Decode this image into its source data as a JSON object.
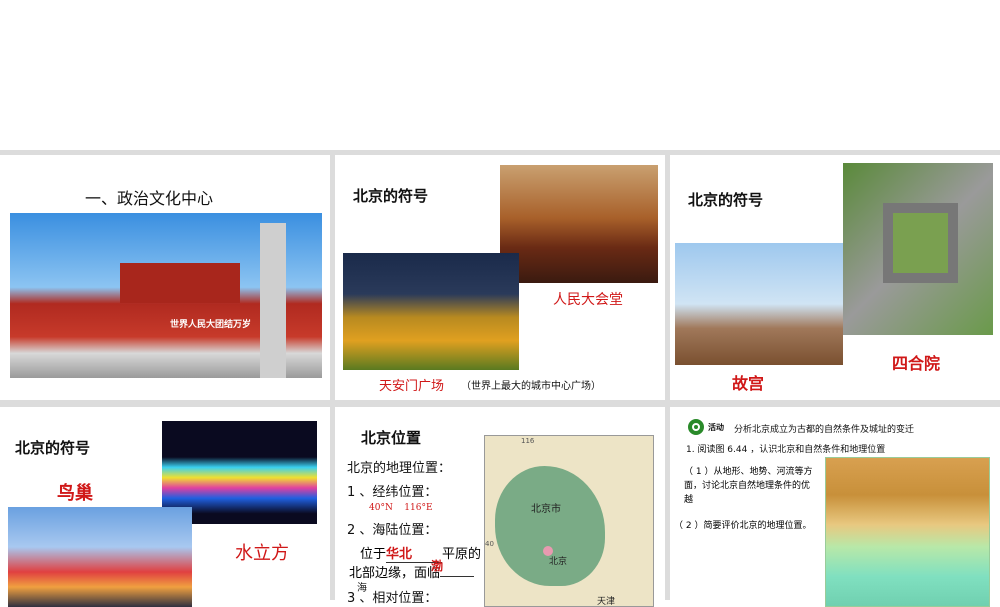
{
  "slides": [
    {
      "title": "一、政治文化中心",
      "banner": "世界人民大团结万岁"
    },
    {
      "title": "北京的符号",
      "caption1": "人民大会堂",
      "caption2": "天安门广场",
      "caption2_note": "（世界上最大的城市中心广场）"
    },
    {
      "title": "北京的符号",
      "caption1": "故宫",
      "caption2": "四合院"
    },
    {
      "title": "北京的符号",
      "caption1": "鸟巢",
      "caption2": "水立方"
    },
    {
      "title": "北京位置",
      "line1": "北京的地理位置：",
      "line2": "1 、经纬位置：",
      "coords": "40°N    116°E",
      "line3": "2 、海陆位置：",
      "line4a": "位于",
      "fill1": "华北",
      "line4b": "平原的",
      "line5": "北部边缘，面临",
      "fill2": "渤",
      "fill3": "海",
      "line6": "3 、相对位置：",
      "map_labels": {
        "lon": "116",
        "lat": "40",
        "city": "北京市",
        "capital": "北京",
        "tianjin": "天津"
      }
    },
    {
      "activity_label": "活动",
      "heading": "分析北京成立为古都的自然条件及城址的变迁",
      "q1": "1. 阅读图 6.44 ，认识北京和自然条件和地理位置",
      "q1a": "（ 1 ）从地形、地势、河流等方面，讨论北京自然地理条件的优越",
      "q2": "（ 2 ）简要评价北京的地理位置。"
    }
  ],
  "colors": {
    "accent_red": "#d01818",
    "activity_green": "#2a8a2a"
  }
}
